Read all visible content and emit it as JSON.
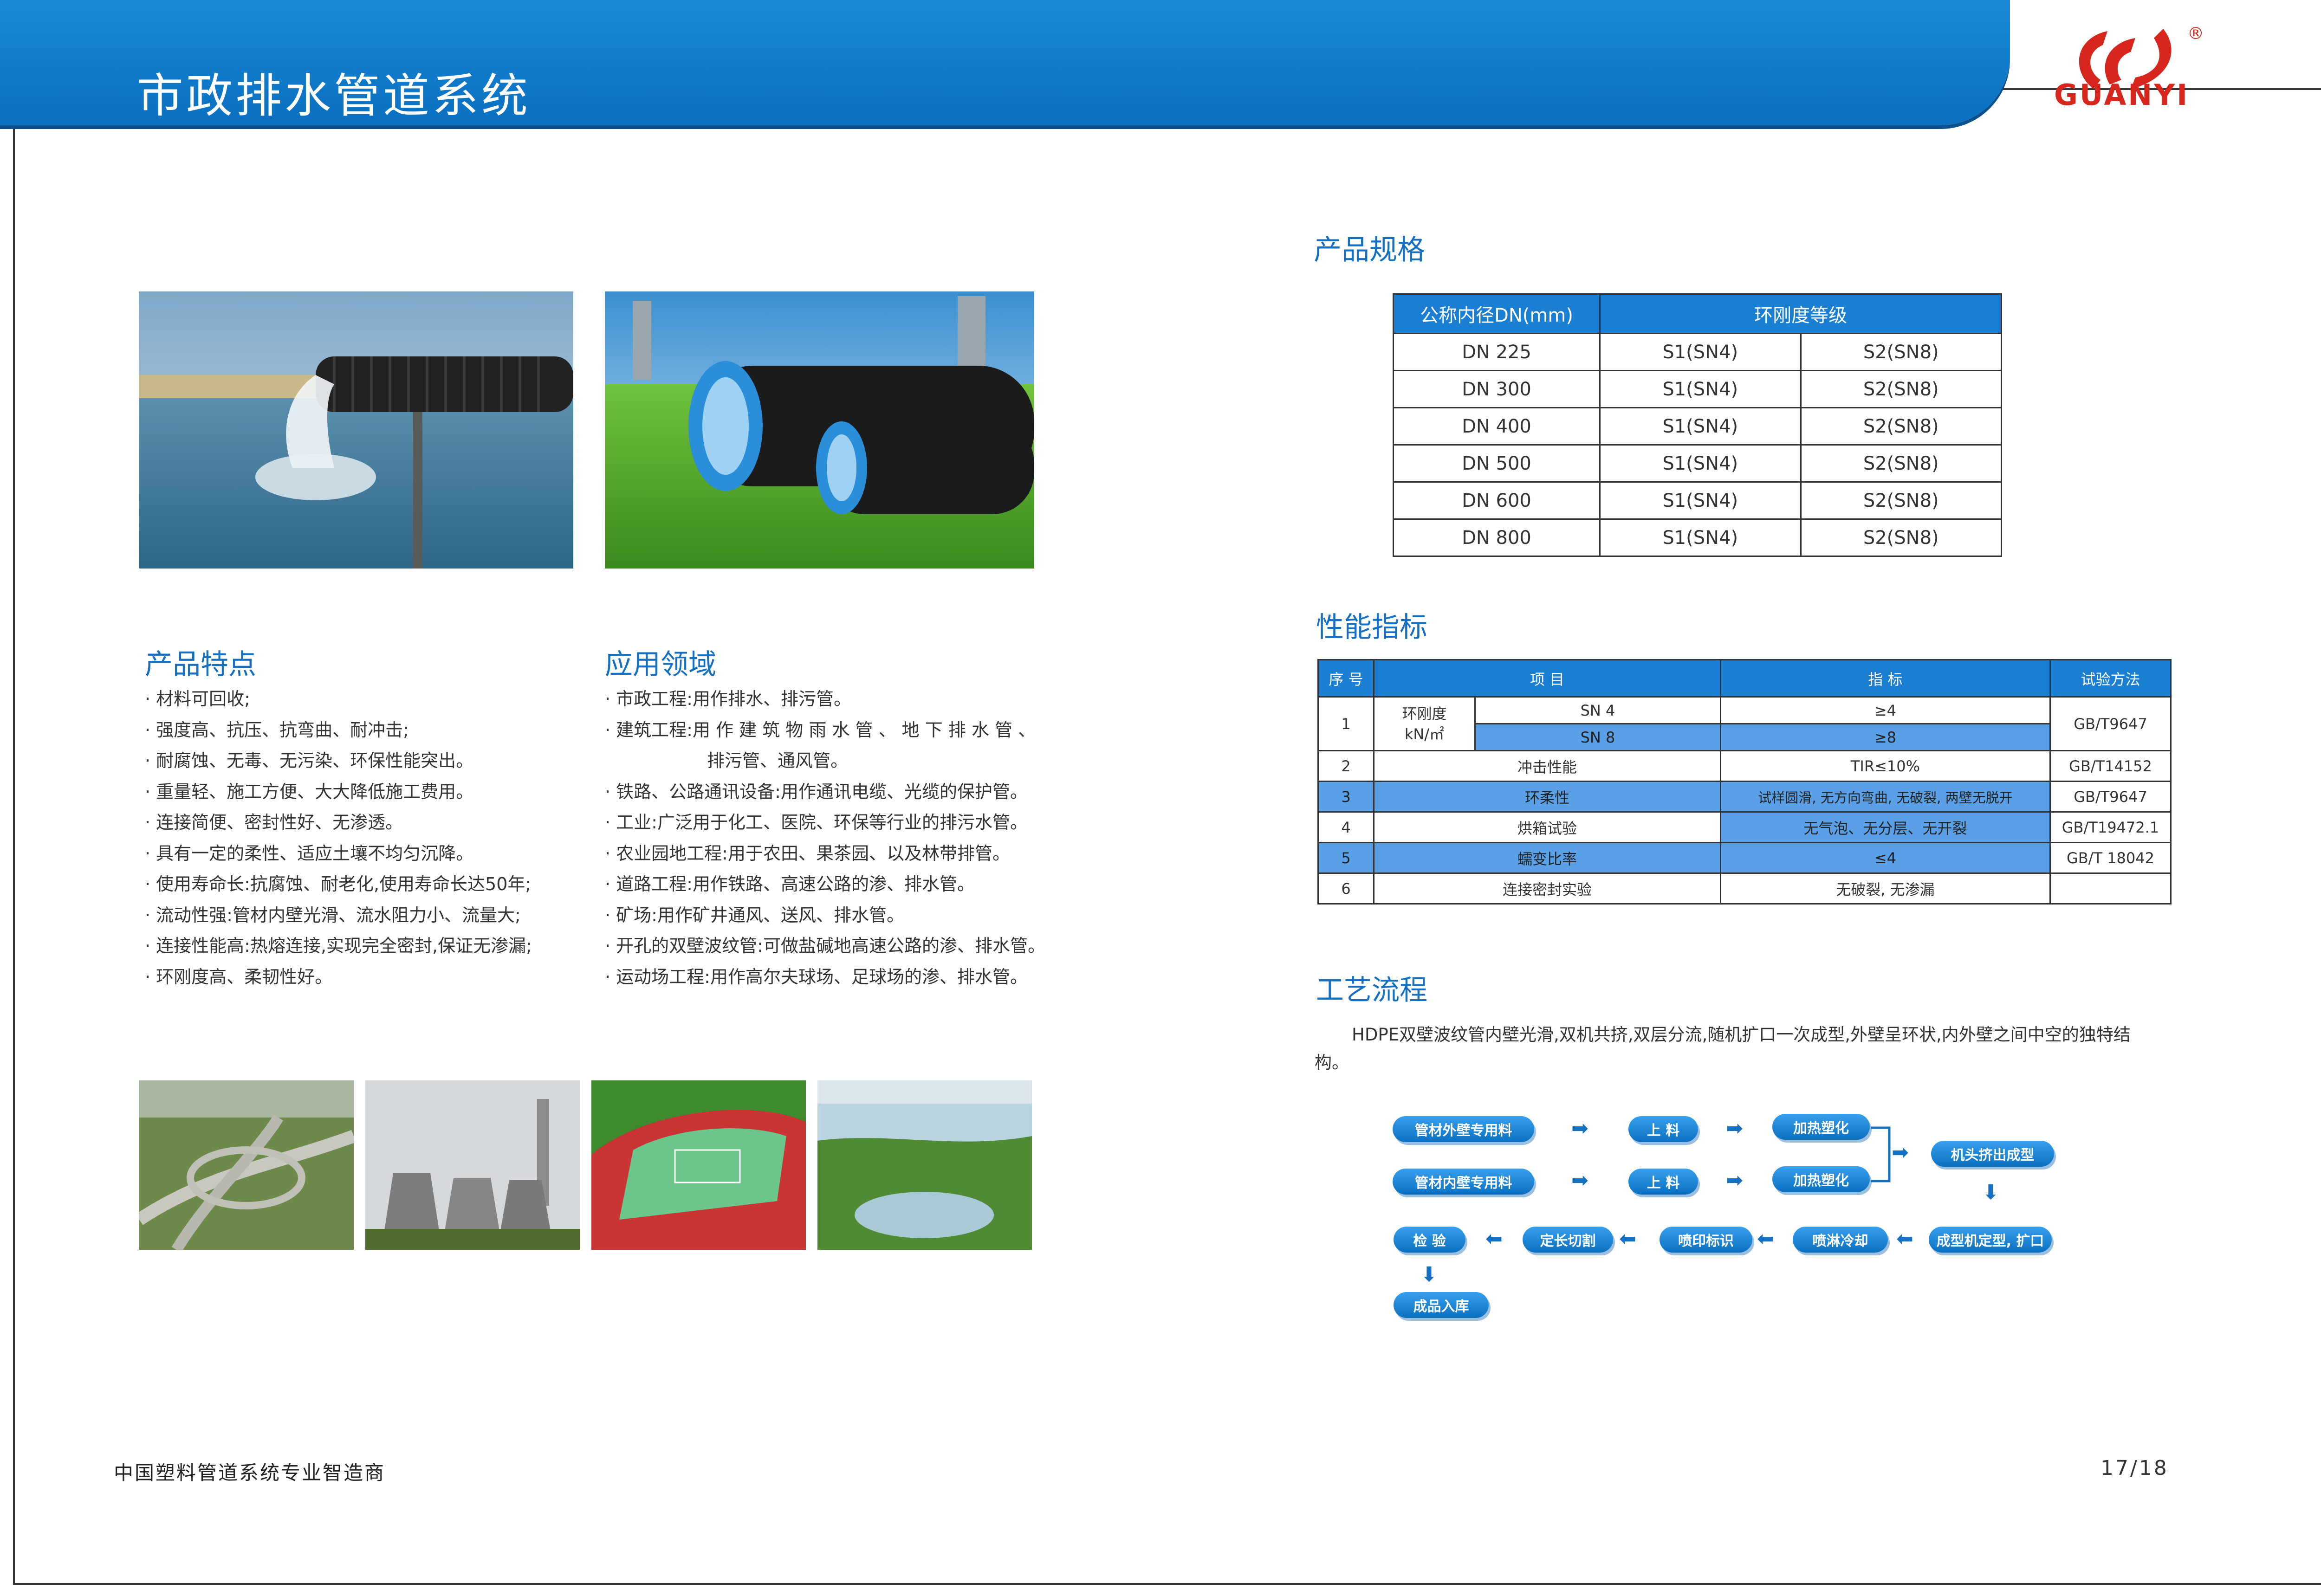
{
  "header": {
    "title": "市政排水管道系统",
    "brand": "GUANYI",
    "registered_mark": "®",
    "banner_color": "#0a6fc0",
    "logo_color": "#d7261e"
  },
  "features": {
    "title": "产品特点",
    "items": [
      "· 材料可回收;",
      "· 强度高、抗压、抗弯曲、耐冲击;",
      "· 耐腐蚀、无毒、无污染、环保性能突出。",
      "· 重量轻、施工方便、大大降低施工费用。",
      "· 连接简便、密封性好、无渗透。",
      "· 具有一定的柔性、适应土壤不均匀沉降。",
      "· 使用寿命长:抗腐蚀、耐老化,使用寿命长达50年;",
      "· 流动性强:管材内壁光滑、流水阻力小、流量大;",
      "· 连接性能高:热熔连接,实现完全密封,保证无渗漏;",
      "· 环刚度高、柔韧性好。"
    ]
  },
  "applications": {
    "title": "应用领域",
    "items": [
      "· 市政工程:用作排水、排污管。",
      "· 建筑工程:用 作 建 筑 物 雨 水 管 、 地 下 排 水 管 、",
      "排污管、通风管。",
      "· 铁路、公路通讯设备:用作通讯电缆、光缆的保护管。",
      "· 工业:广泛用于化工、医院、环保等行业的排污水管。",
      "· 农业园地工程:用于农田、果茶园、以及林带排管。",
      "· 道路工程:用作铁路、高速公路的渗、排水管。",
      "· 矿场:用作矿井通风、送风、排水管。",
      "· 开孔的双壁波纹管:可做盐碱地高速公路的渗、排水管。",
      "· 运动场工程:用作高尔夫球场、足球场的渗、排水管。"
    ]
  },
  "spec": {
    "title": "产品规格",
    "headers": [
      "公称内径DN(mm)",
      "环刚度等级"
    ],
    "rows": [
      [
        "DN 225",
        "S1(SN4)",
        "S2(SN8)"
      ],
      [
        "DN 300",
        "S1(SN4)",
        "S2(SN8)"
      ],
      [
        "DN 400",
        "S1(SN4)",
        "S2(SN8)"
      ],
      [
        "DN 500",
        "S1(SN4)",
        "S2(SN8)"
      ],
      [
        "DN 600",
        "S1(SN4)",
        "S2(SN8)"
      ],
      [
        "DN 800",
        "S1(SN4)",
        "S2(SN8)"
      ]
    ]
  },
  "performance": {
    "title": "性能指标",
    "headers": [
      "序 号",
      "项 目",
      "指 标",
      "试验方法"
    ],
    "row1": {
      "no": "1",
      "item": "环刚度",
      "unit": "kN/㎡",
      "sub1": "SN 4",
      "val1": "≥4",
      "sub2": "SN 8",
      "val2": "≥8",
      "method": "GB/T9647"
    },
    "rows": [
      {
        "no": "2",
        "item": "冲击性能",
        "value": "TIR≤10%",
        "method": "GB/T14152"
      },
      {
        "no": "3",
        "item": "环柔性",
        "value": "试样圆滑, 无方向弯曲, 无破裂, 两壁无脱开",
        "method": "GB/T9647"
      },
      {
        "no": "4",
        "item": "烘箱试验",
        "value": "无气泡、无分层、无开裂",
        "method": "GB/T19472.1"
      },
      {
        "no": "5",
        "item": "蠕变比率",
        "value": "≤4",
        "method": "GB/T 18042"
      },
      {
        "no": "6",
        "item": "连接密封实验",
        "value": "无破裂, 无渗漏",
        "method": ""
      }
    ]
  },
  "process": {
    "title": "工艺流程",
    "description": "HDPE双壁波纹管内壁光滑,双机共挤,双层分流,随机扩口一次成型,外壁呈环状,内外壁之间中空的独特结构。",
    "steps": {
      "outer_material": "管材外壁专用料",
      "inner_material": "管材内壁专用料",
      "feed1": "上 料",
      "feed2": "上 料",
      "heat1": "加热塑化",
      "heat2": "加热塑化",
      "extrude": "机头挤出成型",
      "shape": "成型机定型, 扩口",
      "cool": "喷淋冷却",
      "mark": "喷印标识",
      "cut": "定长切割",
      "inspect": "检 验",
      "store": "成品入库"
    }
  },
  "footer": {
    "left": "中国塑料管道系统专业智造商",
    "page": "17/18"
  }
}
